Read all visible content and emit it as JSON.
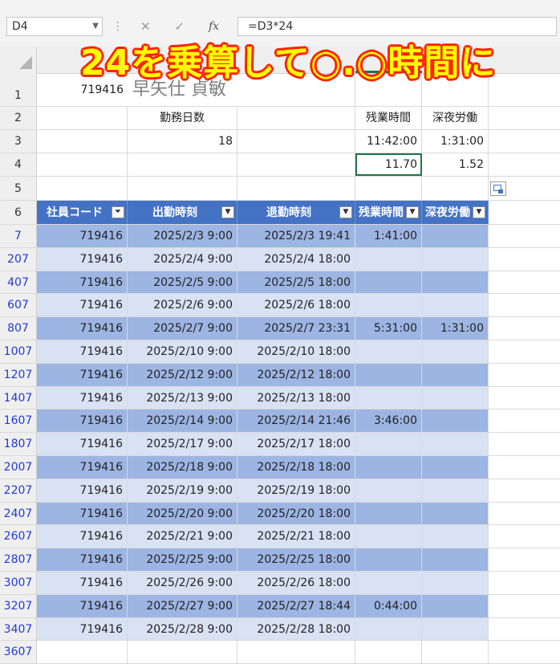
{
  "formula_bar": {
    "name_box": "D4",
    "formula": "=D3*24",
    "cancel": "✕",
    "enter": "✓",
    "fx": "fx"
  },
  "overlay_text": "24を乗算して○.○時間に",
  "top_rows": {
    "r1": {
      "num": "1",
      "a": "719416",
      "name": "早矢仕 貞敏"
    },
    "r2": {
      "num": "2",
      "b": "勤務日数",
      "d": "残業時間",
      "e": "深夜労働"
    },
    "r3": {
      "num": "3",
      "b": "18",
      "d": "11:42:00",
      "e": "1:31:00"
    },
    "r4": {
      "num": "4",
      "d": "11.70",
      "e": "1.52"
    },
    "r5": {
      "num": "5"
    }
  },
  "table": {
    "header_row_num": "6",
    "headers": [
      "社員コード",
      "出勤時刻",
      "退勤時刻",
      "残業時間",
      "深夜労働"
    ],
    "rows": [
      {
        "num": "7",
        "code": "719416",
        "in": "2025/2/3 9:00",
        "out": "2025/2/3 19:41",
        "ot": "1:41:00",
        "night": ""
      },
      {
        "num": "207",
        "code": "719416",
        "in": "2025/2/4 9:00",
        "out": "2025/2/4 18:00",
        "ot": "",
        "night": ""
      },
      {
        "num": "407",
        "code": "719416",
        "in": "2025/2/5 9:00",
        "out": "2025/2/5 18:00",
        "ot": "",
        "night": ""
      },
      {
        "num": "607",
        "code": "719416",
        "in": "2025/2/6 9:00",
        "out": "2025/2/6 18:00",
        "ot": "",
        "night": ""
      },
      {
        "num": "807",
        "code": "719416",
        "in": "2025/2/7 9:00",
        "out": "2025/2/7 23:31",
        "ot": "5:31:00",
        "night": "1:31:00"
      },
      {
        "num": "1007",
        "code": "719416",
        "in": "2025/2/10 9:00",
        "out": "2025/2/10 18:00",
        "ot": "",
        "night": ""
      },
      {
        "num": "1207",
        "code": "719416",
        "in": "2025/2/12 9:00",
        "out": "2025/2/12 18:00",
        "ot": "",
        "night": ""
      },
      {
        "num": "1407",
        "code": "719416",
        "in": "2025/2/13 9:00",
        "out": "2025/2/13 18:00",
        "ot": "",
        "night": ""
      },
      {
        "num": "1607",
        "code": "719416",
        "in": "2025/2/14 9:00",
        "out": "2025/2/14 21:46",
        "ot": "3:46:00",
        "night": ""
      },
      {
        "num": "1807",
        "code": "719416",
        "in": "2025/2/17 9:00",
        "out": "2025/2/17 18:00",
        "ot": "",
        "night": ""
      },
      {
        "num": "2007",
        "code": "719416",
        "in": "2025/2/18 9:00",
        "out": "2025/2/18 18:00",
        "ot": "",
        "night": ""
      },
      {
        "num": "2207",
        "code": "719416",
        "in": "2025/2/19 9:00",
        "out": "2025/2/19 18:00",
        "ot": "",
        "night": ""
      },
      {
        "num": "2407",
        "code": "719416",
        "in": "2025/2/20 9:00",
        "out": "2025/2/20 18:00",
        "ot": "",
        "night": ""
      },
      {
        "num": "2607",
        "code": "719416",
        "in": "2025/2/21 9:00",
        "out": "2025/2/21 18:00",
        "ot": "",
        "night": ""
      },
      {
        "num": "2807",
        "code": "719416",
        "in": "2025/2/25 9:00",
        "out": "2025/2/25 18:00",
        "ot": "",
        "night": ""
      },
      {
        "num": "3007",
        "code": "719416",
        "in": "2025/2/26 9:00",
        "out": "2025/2/26 18:00",
        "ot": "",
        "night": ""
      },
      {
        "num": "3207",
        "code": "719416",
        "in": "2025/2/27 9:00",
        "out": "2025/2/27 18:44",
        "ot": "0:44:00",
        "night": ""
      },
      {
        "num": "3407",
        "code": "719416",
        "in": "2025/2/28 9:00",
        "out": "2025/2/28 18:00",
        "ot": "",
        "night": ""
      }
    ],
    "after_row_num": "3607"
  },
  "colors": {
    "header_blue": "#4472c4",
    "band_dark": "#9db5e3",
    "band_light": "#d8e2f3",
    "selection_green": "#217346",
    "filtered_rownum": "#1f3bd6"
  }
}
